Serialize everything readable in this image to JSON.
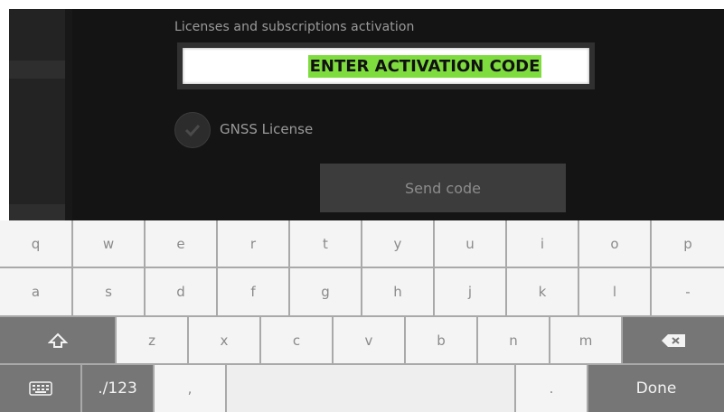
{
  "screen": {
    "section_title": "Licenses and subscriptions activation",
    "activation_input_value": "ENTER ACTIVATION CODE",
    "license_option_label": "GNSS License",
    "send_button_label": "Send code"
  },
  "keyboard": {
    "row1": [
      "q",
      "w",
      "e",
      "r",
      "t",
      "y",
      "u",
      "i",
      "o",
      "p"
    ],
    "row2": [
      "a",
      "s",
      "d",
      "f",
      "g",
      "h",
      "j",
      "k",
      "l",
      "-"
    ],
    "row3": [
      "z",
      "x",
      "c",
      "v",
      "b",
      "n",
      "m"
    ],
    "mode_key_label": "./123",
    "comma_key_label": ",",
    "period_key_label": ".",
    "done_key_label": "Done"
  },
  "colors": {
    "highlight": "#7fdc3f",
    "dark_bg": "#141414"
  }
}
